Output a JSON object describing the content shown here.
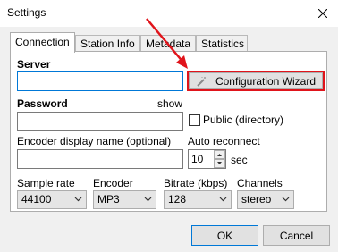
{
  "window": {
    "title": "Settings"
  },
  "tabs": [
    {
      "label": "Connection"
    },
    {
      "label": "Station Info"
    },
    {
      "label": "Metadata"
    },
    {
      "label": "Statistics"
    }
  ],
  "connection": {
    "server_label": "Server",
    "server_value": "",
    "wizard_label": "Configuration Wizard",
    "password_label": "Password",
    "show_label": "show",
    "password_value": "",
    "public_label": "Public (directory)",
    "encoder_name_label": "Encoder display name (optional)",
    "encoder_name_value": "",
    "auto_reconnect_label": "Auto reconnect",
    "auto_reconnect_value": "10",
    "sec_label": "sec",
    "sample_rate_label": "Sample rate",
    "sample_rate_value": "44100",
    "encoder_label": "Encoder",
    "encoder_value": "MP3",
    "bitrate_label": "Bitrate (kbps)",
    "bitrate_value": "128",
    "channels_label": "Channels",
    "channels_value": "stereo"
  },
  "footer": {
    "ok_label": "OK",
    "cancel_label": "Cancel"
  },
  "colors": {
    "highlight": "#e0141b",
    "focus": "#0078d7"
  }
}
